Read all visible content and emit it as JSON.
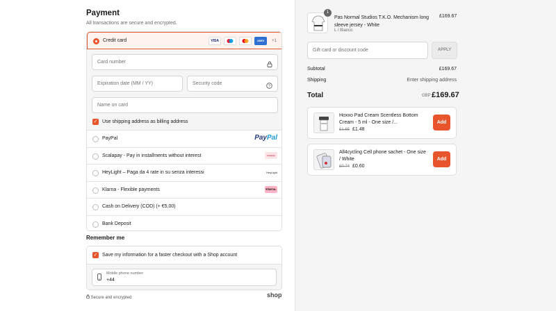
{
  "payment": {
    "title": "Payment",
    "subtitle": "All transactions are secure and encrypted.",
    "credit_card": {
      "label": "Credit card",
      "card_icons": [
        "VISA",
        "MC",
        "MC",
        "AMEX"
      ],
      "more": "+1",
      "card_number_placeholder": "Card number",
      "expiry_placeholder": "Expiration date (MM / YY)",
      "security_placeholder": "Security code",
      "name_placeholder": "Name on card",
      "billing_label": "Use shipping address as billing address"
    },
    "options": [
      {
        "label": "PayPal",
        "logo": "PayPal"
      },
      {
        "label": "Scalapay - Pay in installments without interest",
        "logo": "scalapay"
      },
      {
        "label": "HeyLight – Paga da 4 rate in su senza interessi",
        "logo": "HeyLight"
      },
      {
        "label": "Klarna - Flexible payments",
        "logo": "Klarna."
      },
      {
        "label": "Cash on Delivery (COD) (+ €5,00)",
        "logo": ""
      },
      {
        "label": "Bank Deposit",
        "logo": ""
      }
    ]
  },
  "remember": {
    "title": "Remember me",
    "save_label": "Save my information for a faster checkout with a Shop account",
    "phone_label": "Mobile phone number",
    "phone_value": "+44"
  },
  "footer": {
    "secure": "Secure and encrypted",
    "shop": "shop"
  },
  "order": {
    "item": {
      "qty": "1",
      "title": "Pas Normal Studios T.K.O. Mechanism long sleeve jersey - White",
      "variant": "L / Bianco",
      "price": "£169.67"
    },
    "discount_placeholder": "Gift card or discount code",
    "apply": "APPLY",
    "subtotal_label": "Subtotal",
    "subtotal_value": "£169.67",
    "shipping_label": "Shipping",
    "shipping_value": "Enter shipping address",
    "total_label": "Total",
    "currency": "GBP",
    "total_value": "£169.67",
    "upsells": [
      {
        "title": "Hoxxo Pad Cream Scentless Bottom Cream - 5 ml - One size /...",
        "old_price": "£1.65",
        "price": "£1.48",
        "button": "Add"
      },
      {
        "title": "All4cycling Cell phone sachet - One size / White",
        "old_price": "£0.74",
        "price": "£0.60",
        "button": "Add"
      }
    ]
  },
  "colors": {
    "accent": "#e8542b"
  }
}
